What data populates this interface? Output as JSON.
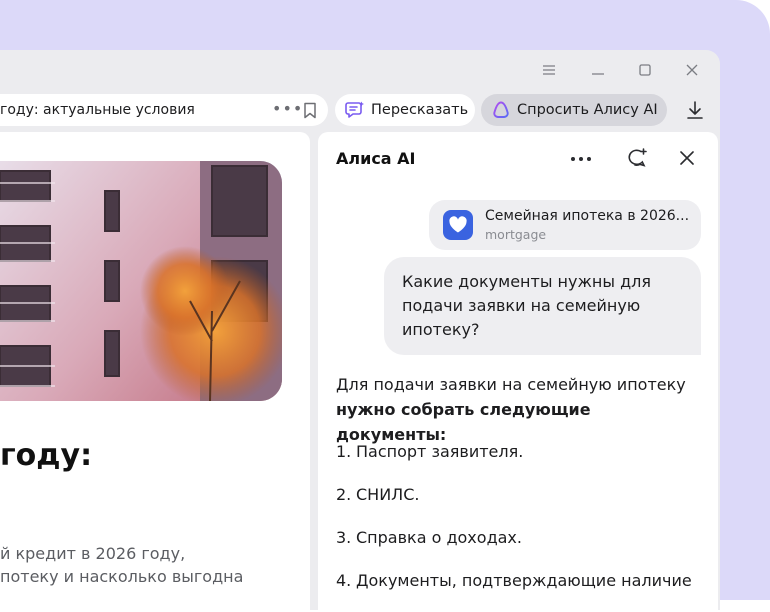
{
  "toolbar": {
    "address_text": "году: актуальные условия",
    "retell_label": "Пересказать",
    "ask_alice_label": "Спросить Алису AI"
  },
  "window_controls": [
    "menu-icon",
    "minimize-icon",
    "maximize-icon",
    "close-icon"
  ],
  "article": {
    "headline": "году:",
    "lead_line1": "й кредит в 2026 году,",
    "lead_line2": "потеку и насколько выгодна"
  },
  "alice": {
    "title": "Алиса AI",
    "source": {
      "title": "Семейная ипотека в 2026...",
      "subtitle": "mortgage"
    },
    "question": "Какие документы нужны для подачи заявки на семейную ипотеку?",
    "answer_intro_plain": "Для подачи заявки на семейную ипотеку ",
    "answer_intro_bold": "нужно собрать следующие документы:",
    "items": [
      {
        "num": "1.",
        "text": "Паспорт заявителя."
      },
      {
        "num": "2.",
        "text": "СНИЛС."
      },
      {
        "num": "3.",
        "text": "Справка о доходах."
      },
      {
        "num": "4.",
        "text": "Документы, подтверждающие наличие"
      }
    ]
  },
  "colors": {
    "background_panel": "#dcd9f9",
    "window_chrome": "#ececef",
    "accent_blue": "#3a63e0",
    "ask_chip": "#d6d6dc"
  }
}
